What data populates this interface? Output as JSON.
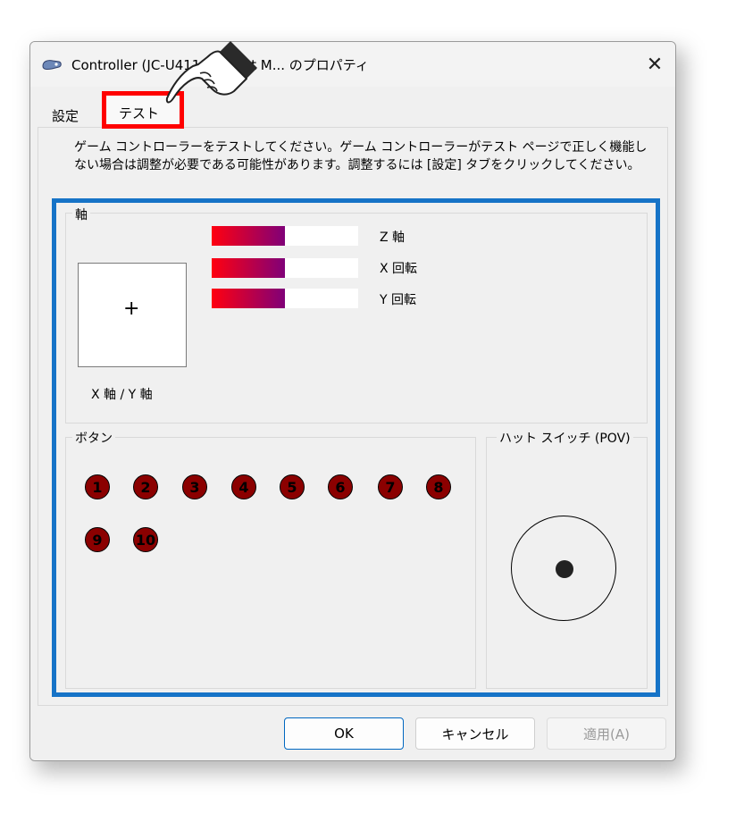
{
  "window": {
    "title": "Controller (JC-U4113S Input M... のプロパティ",
    "close_glyph": "✕"
  },
  "tabs": [
    {
      "label": "設定"
    },
    {
      "label": "テスト"
    }
  ],
  "instructions": "ゲーム コントローラーをテストしてください。ゲーム コントローラーがテスト ページで正しく機能しない場合は調整が必要である可能性があります。調整するには [設定] タブをクリックしてください。",
  "axes": {
    "group_label": "軸",
    "crosshair_glyph": "+",
    "xy_caption": "X 軸 / Y 軸",
    "meters": [
      {
        "label": "Z 軸",
        "level": 0.5
      },
      {
        "label": "X 回転",
        "level": 0.5
      },
      {
        "label": "Y 回転",
        "level": 0.5
      }
    ],
    "meter_color_start": "#ff0010",
    "meter_color_end": "#800078"
  },
  "buttons": {
    "group_label": "ボタン",
    "items": [
      "1",
      "2",
      "3",
      "4",
      "5",
      "6",
      "7",
      "8",
      "9",
      "10"
    ],
    "color": "#8b0000"
  },
  "pov": {
    "group_label": "ハット スイッチ (POV)"
  },
  "footer": {
    "ok_label": "OK",
    "cancel_label": "キャンセル",
    "apply_label": "適用(A)"
  },
  "highlight_colors": {
    "tab_box": "#ff0000",
    "test_area_box": "#1673c7"
  }
}
